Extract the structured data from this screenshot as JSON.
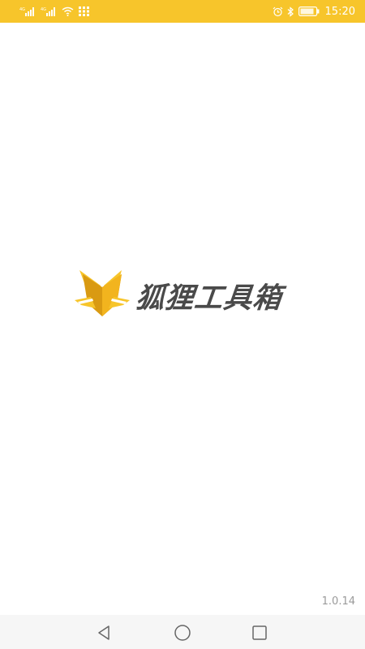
{
  "status_bar": {
    "time": "15:20",
    "signal_label_1": "4G",
    "signal_label_2": "4G",
    "battery_icon": "battery-icon",
    "colors": {
      "background": "#f7c52b",
      "foreground": "#ffffff"
    }
  },
  "splash": {
    "brand_name": "狐狸工具箱",
    "logo_icon": "fox-logo-icon",
    "colors": {
      "logo_primary": "#f7c52b",
      "logo_dark": "#d99a12",
      "text": "#4a4a4a"
    }
  },
  "footer": {
    "version": "1.0.14"
  },
  "nav_bar": {
    "back_icon": "back-triangle-icon",
    "home_icon": "home-circle-icon",
    "recents_icon": "recents-square-icon"
  }
}
